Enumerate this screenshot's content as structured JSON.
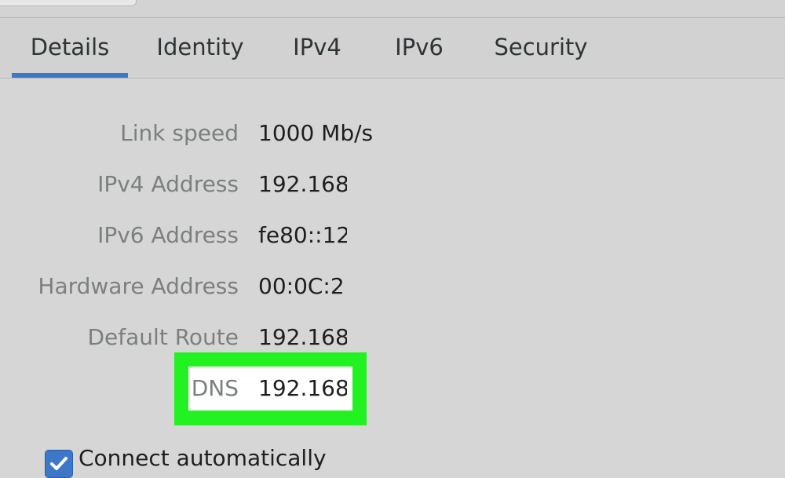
{
  "tabs": [
    {
      "label": "Details",
      "active": true
    },
    {
      "label": "Identity",
      "active": false
    },
    {
      "label": "IPv4",
      "active": false
    },
    {
      "label": "IPv6",
      "active": false
    },
    {
      "label": "Security",
      "active": false
    }
  ],
  "details": {
    "link_speed": {
      "label": "Link speed",
      "value": "1000 Mb/s"
    },
    "ipv4_address": {
      "label": "IPv4 Address",
      "value": "192.168."
    },
    "ipv6_address": {
      "label": "IPv6 Address",
      "value": "fe80::12"
    },
    "hardware_address": {
      "label": "Hardware Address",
      "value": "00:0C:2"
    },
    "default_route": {
      "label": "Default Route",
      "value": "192.168."
    },
    "dns": {
      "label": "DNS",
      "value": "192.168."
    }
  },
  "connect_automatically": {
    "label": "Connect automatically",
    "checked": true
  },
  "colors": {
    "accent": "#3d78c8",
    "highlight": "#22f222",
    "background": "#d6d6d6"
  }
}
